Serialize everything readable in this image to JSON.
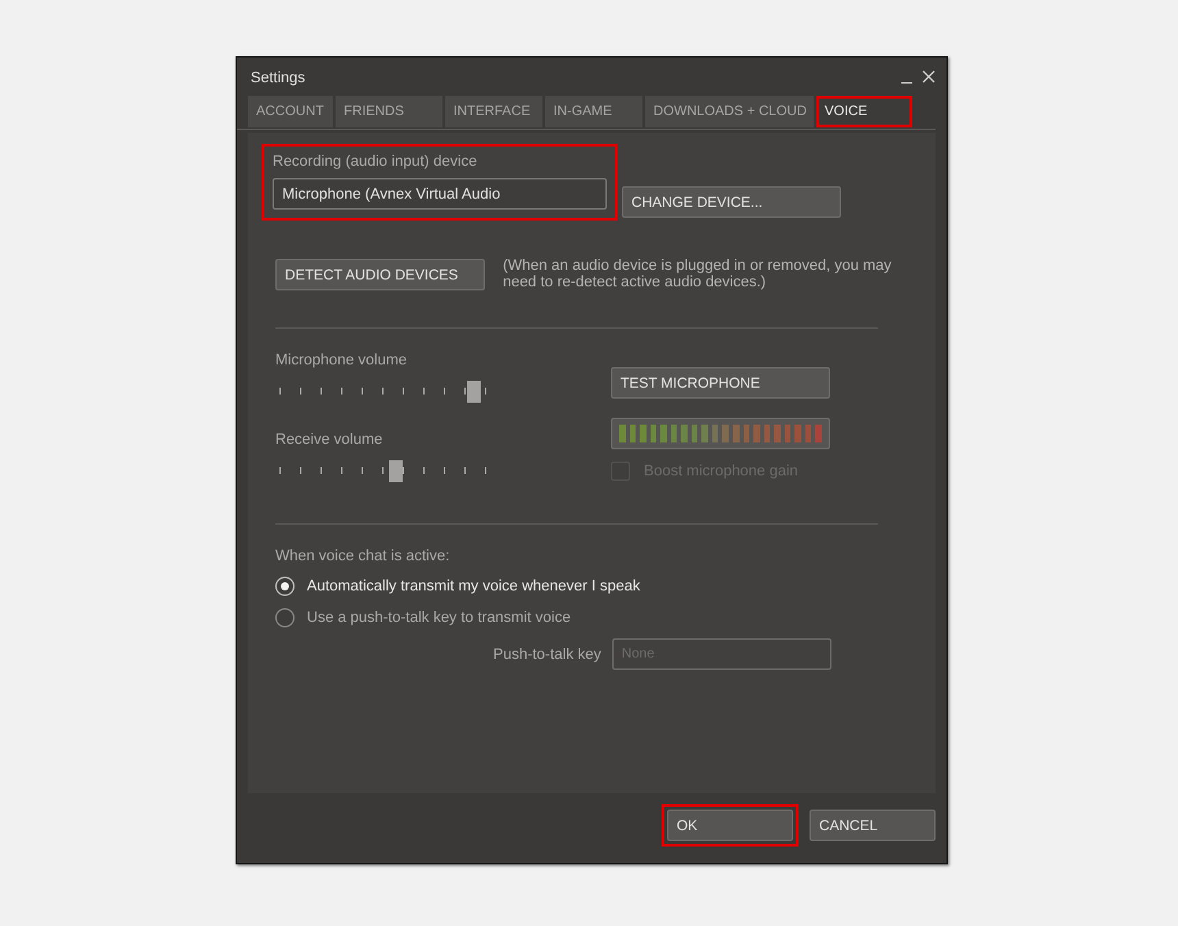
{
  "window": {
    "title": "Settings"
  },
  "tabs": [
    {
      "label": "ACCOUNT",
      "selected": false,
      "highlighted": false
    },
    {
      "label": "FRIENDS",
      "selected": false,
      "highlighted": false
    },
    {
      "label": "INTERFACE",
      "selected": false,
      "highlighted": false
    },
    {
      "label": "IN-GAME",
      "selected": false,
      "highlighted": false
    },
    {
      "label": "DOWNLOADS + CLOUD",
      "selected": false,
      "highlighted": false
    },
    {
      "label": "VOICE",
      "selected": true,
      "highlighted": true
    }
  ],
  "device": {
    "label": "Recording (audio input) device",
    "value": "Microphone (Avnex Virtual Audio",
    "highlighted": true,
    "button": "CHANGE DEVICE..."
  },
  "detect": {
    "button": "DETECT AUDIO DEVICES",
    "note": "(When an audio device is plugged in or removed, you may need to re-detect active audio devices.)"
  },
  "volumes": [
    {
      "label": "Microphone volume",
      "level": 0.93
    },
    {
      "label": "Receive volume",
      "level": 0.55
    }
  ],
  "test_button": "TEST MICROPHONE",
  "boost": {
    "label": "Boost microphone gain",
    "checked": false,
    "disabled": true
  },
  "transmit": {
    "label": "When voice chat is active:",
    "options": [
      {
        "label": "Automatically transmit my voice whenever I speak",
        "selected": true
      },
      {
        "label": "Use a push-to-talk key to transmit voice",
        "selected": false
      }
    ]
  },
  "push_key": {
    "label": "Push-to-talk key",
    "placeholder": "None"
  },
  "buttons": [
    {
      "label": "OK",
      "highlighted": true
    },
    {
      "label": "CANCEL",
      "highlighted": false
    }
  ]
}
